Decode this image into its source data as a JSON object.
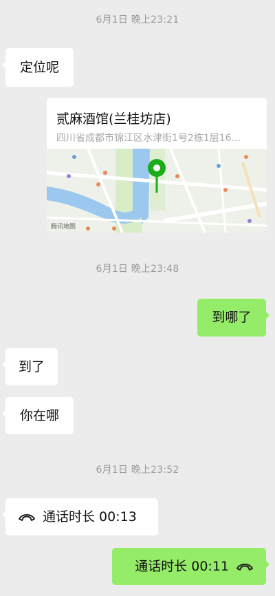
{
  "timestamps": [
    "6月1日 晚上23:21",
    "6月1日 晚上23:48",
    "6月1日 晚上23:52"
  ],
  "messages": [
    {
      "text": "定位呢"
    },
    {
      "title": "贰麻酒馆(兰桂坊店)",
      "address": "四川省成都市锦江区水津街1号2栋1层16...",
      "map_watermark": "腾讯地图"
    },
    {
      "text": "到哪了"
    },
    {
      "text": "到了"
    },
    {
      "text": "你在哪"
    },
    {
      "text": "通话时长 00:13"
    },
    {
      "text": "通话时长 00:11"
    }
  ],
  "icons": {
    "location_pin": "map-pin-icon",
    "call": "phone-hangup-icon"
  },
  "colors": {
    "background": "#ececec",
    "sent_bubble": "#95ec69",
    "received_bubble": "#ffffff",
    "pin": "#1aad19"
  }
}
